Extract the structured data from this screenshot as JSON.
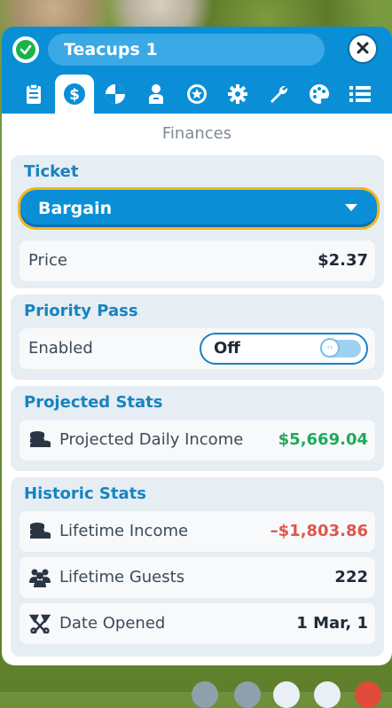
{
  "window": {
    "title": "Teacups 1",
    "status_icon": "checkmark-icon",
    "close_icon": "close-icon"
  },
  "tabs": [
    {
      "name": "tab-info",
      "icon": "clipboard-icon",
      "active": false
    },
    {
      "name": "tab-finances",
      "icon": "dollar-icon",
      "active": true
    },
    {
      "name": "tab-ratings",
      "icon": "pie-chart-icon",
      "active": false
    },
    {
      "name": "tab-staff",
      "icon": "person-icon",
      "active": false
    },
    {
      "name": "tab-rating-star",
      "icon": "star-badge-icon",
      "active": false
    },
    {
      "name": "tab-settings",
      "icon": "gear-icon",
      "active": false
    },
    {
      "name": "tab-maintenance",
      "icon": "wrench-icon",
      "active": false
    },
    {
      "name": "tab-paint",
      "icon": "palette-icon",
      "active": false
    },
    {
      "name": "tab-list",
      "icon": "list-icon",
      "active": false
    }
  ],
  "heading": "Finances",
  "ticket": {
    "title": "Ticket",
    "selected": "Bargain",
    "price_label": "Price",
    "price_value": "$2.37"
  },
  "priority_pass": {
    "title": "Priority Pass",
    "enabled_label": "Enabled",
    "toggle_value": "Off"
  },
  "projected": {
    "title": "Projected Stats",
    "daily_income_label": "Projected Daily Income",
    "daily_income_value": "$5,669.04"
  },
  "historic": {
    "title": "Historic Stats",
    "lifetime_income_label": "Lifetime Income",
    "lifetime_income_value": "–$1,803.86",
    "lifetime_guests_label": "Lifetime Guests",
    "lifetime_guests_value": "222",
    "date_opened_label": "Date Opened",
    "date_opened_value": "1 Mar, 1"
  },
  "colors": {
    "accent": "#0a8fd6",
    "positive": "#1eab5a",
    "negative": "#e0564a",
    "highlight": "#f2b51e"
  }
}
